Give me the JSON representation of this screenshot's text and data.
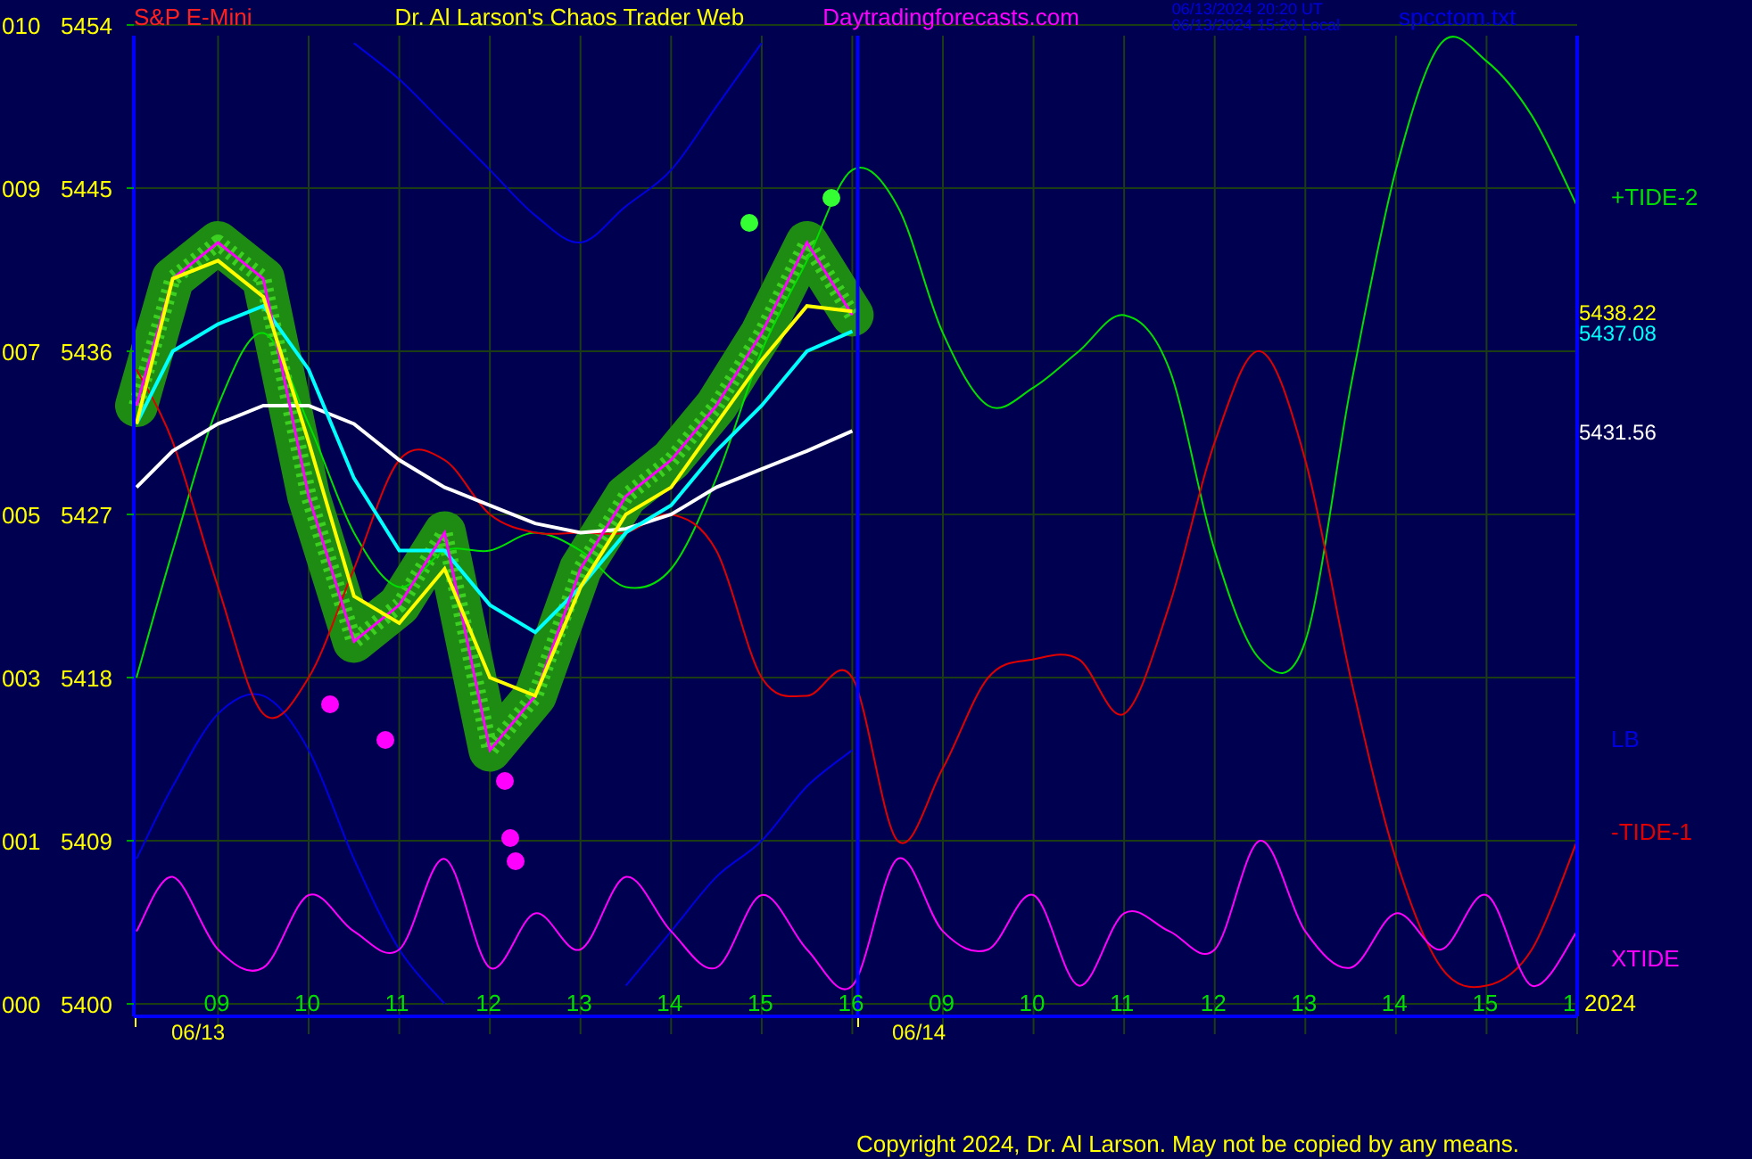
{
  "header": {
    "instrument": "S&P E-Mini",
    "title": "Dr. Al Larson's Chaos Trader Web",
    "site": "Daytradingforecasts.com",
    "timestamps": [
      "06/13/2024 20:20 UT",
      "06/13/2024 15:20 Local"
    ],
    "file": "spcctom.txt"
  },
  "price_codes": [
    "010",
    "009",
    "007",
    "005",
    "003",
    "001",
    "000"
  ],
  "chart_data": {
    "type": "line",
    "x": [
      8.1,
      8.5,
      9,
      9.5,
      10,
      10.5,
      11,
      11.5,
      12,
      12.5,
      13,
      13.5,
      14,
      14.5,
      15,
      15.5,
      16,
      16.5,
      17,
      17.5,
      18,
      18.5,
      19,
      19.5,
      20,
      20.5,
      21,
      21.5,
      22,
      22.5,
      23,
      23.5,
      24
    ],
    "series": [
      {
        "color": "#ffff00",
        "values": [
          5432,
          5440,
          5441,
          5439,
          5431,
          5422.5,
          5421,
          5424,
          5418,
          5417,
          5423,
          5427,
          5428.5,
          5432,
          5435.5,
          5438.5,
          5438.2,
          null,
          null,
          null,
          null,
          null,
          null,
          null,
          null,
          null,
          null,
          null,
          null,
          null,
          null,
          null,
          null
        ]
      },
      {
        "color": "#00ffff",
        "values": [
          5432,
          5436,
          5437.5,
          5438.5,
          5435,
          5429,
          5425,
          5425,
          5422,
          5420.5,
          5423,
          5426,
          5427.5,
          5430.5,
          5433,
          5436,
          5437.1,
          null,
          null,
          null,
          null,
          null,
          null,
          null,
          null,
          null,
          null,
          null,
          null,
          null,
          null,
          null,
          null
        ]
      },
      {
        "color": "#ffffff",
        "values": [
          5428.5,
          5430.5,
          5432,
          5433,
          5433,
          5432,
          5430,
          5428.5,
          5427.5,
          5426.5,
          5426,
          5426.2,
          5427,
          5428.5,
          5429.5,
          5430.5,
          5431.6,
          null,
          null,
          null,
          null,
          null,
          null,
          null,
          null,
          null,
          null,
          null,
          null,
          null,
          null,
          null,
          null
        ]
      },
      {
        "color": "#ff00ff",
        "values": [
          5433,
          5440,
          5442,
          5440,
          5428,
          5420,
          5422,
          5426,
          5414,
          5417,
          5424,
          5428,
          5430,
          5433,
          5437,
          5442,
          5438,
          null,
          null,
          null,
          null,
          null,
          null,
          null,
          null,
          null,
          null,
          null,
          null,
          null,
          null,
          null,
          null
        ]
      },
      {
        "name": "+TIDE-2",
        "color": "#00e000",
        "values": [
          5418,
          5425,
          5433,
          5437,
          5432,
          5426,
          5423,
          5425,
          5425,
          5426,
          5425,
          5423,
          5424,
          5429,
          5436,
          5441,
          5446,
          5444,
          5437,
          5433,
          5434,
          5436,
          5438,
          5435,
          5425,
          5419,
          5420,
          5434,
          5446,
          5453,
          5452,
          5449,
          5444
        ]
      },
      {
        "name": "LB",
        "color": "#0000e0",
        "values": [
          5408,
          5412,
          5416,
          5417,
          5414,
          5408,
          5403,
          5400,
          null,
          null,
          null,
          5401,
          5404,
          5407,
          5409,
          5412,
          5414,
          null,
          null,
          null,
          null,
          null,
          null,
          null,
          null,
          null,
          null,
          null,
          null,
          null,
          null,
          null,
          null
        ]
      },
      {
        "color": "#0000e0",
        "values": [
          null,
          null,
          null,
          null,
          null,
          5453,
          5451,
          5448.5,
          5446,
          5443.5,
          5442,
          5444,
          5446,
          5449.5,
          5453,
          null,
          null,
          null,
          null,
          null,
          null,
          null,
          null,
          null,
          null,
          null,
          null,
          null,
          null,
          null,
          null,
          null,
          null
        ]
      },
      {
        "name": "-TIDE-1",
        "color": "#e00000",
        "values": [
          5435,
          5431,
          5423,
          5416,
          5418,
          5424,
          5430,
          5430,
          5427,
          5426,
          5426,
          5426,
          5427,
          5425,
          5418,
          5417,
          5418,
          5409,
          5413,
          5418,
          5419,
          5419,
          5416,
          5422,
          5431,
          5436,
          5430,
          5418,
          5408,
          5402,
          5401,
          5403,
          5409
        ]
      },
      {
        "name": "XTIDE",
        "color": "#ff00ff",
        "values": [
          5404,
          5407,
          5403,
          5402,
          5406,
          5404,
          5403,
          5408,
          5402,
          5405,
          5403,
          5407,
          5404,
          5402,
          5406,
          5403,
          5401,
          5408,
          5404,
          5403,
          5406,
          5401,
          5405,
          5404,
          5403,
          5409,
          5404,
          5402,
          5405,
          5403,
          5406,
          5401,
          5404
        ]
      }
    ],
    "xlim": [
      8.07,
      24
    ],
    "ylim": [
      5400,
      5454
    ],
    "yticks": [
      {
        "value": 5454,
        "label": "5454"
      },
      {
        "value": 5445,
        "label": "5445"
      },
      {
        "value": 5436,
        "label": "5436"
      },
      {
        "value": 5427,
        "label": "5427"
      },
      {
        "value": 5418,
        "label": "5418"
      },
      {
        "value": 5409,
        "label": "5409"
      },
      {
        "value": 5400,
        "label": "5400"
      }
    ],
    "xticks": [
      {
        "value": 9,
        "label": "09"
      },
      {
        "value": 10,
        "label": "10"
      },
      {
        "value": 11,
        "label": "11"
      },
      {
        "value": 12,
        "label": "12"
      },
      {
        "value": 13,
        "label": "13"
      },
      {
        "value": 14,
        "label": "14"
      },
      {
        "value": 15,
        "label": "15"
      },
      {
        "value": 16,
        "label": "16"
      }
    ],
    "grid": true,
    "ref_lines": [
      {
        "axis": "x",
        "value": 16,
        "color": "#0000ff"
      }
    ]
  },
  "next_day_hours": [
    "09",
    "10",
    "11",
    "12",
    "13",
    "14",
    "15",
    "1"
  ],
  "dates": [
    "06/13",
    "06/14"
  ],
  "year": "2024",
  "value_readouts": [
    {
      "text": "5438.22",
      "color": "#ffff00"
    },
    {
      "text": "5437.08",
      "color": "#00ffff"
    },
    {
      "text": "5431.56",
      "color": "#ffffff"
    }
  ],
  "copyright": "Copyright 2024, Dr. Al Larson. May not be copied by any means."
}
